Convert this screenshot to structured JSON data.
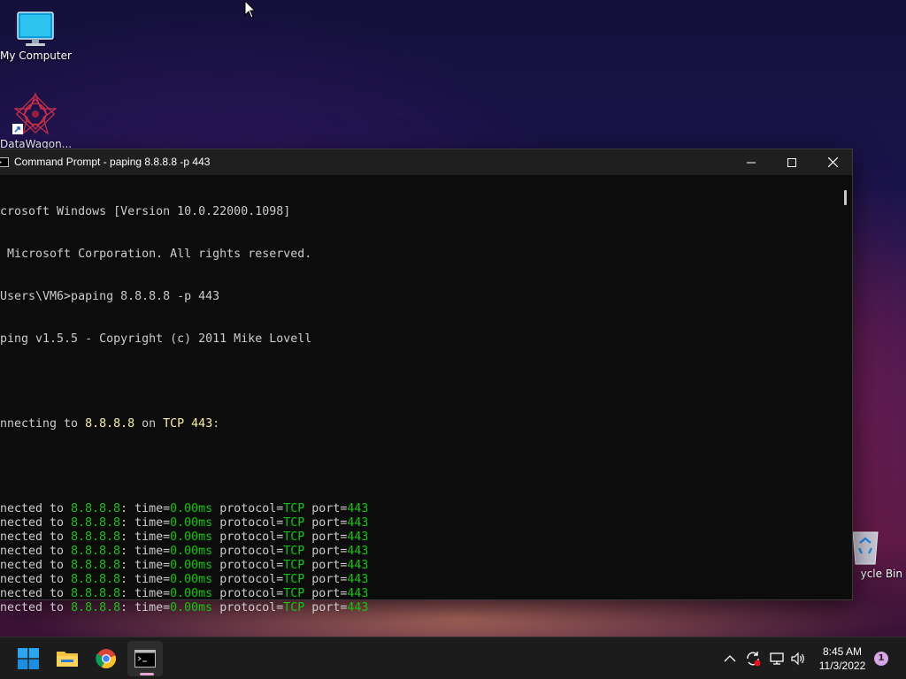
{
  "desktop": {
    "icons": [
      {
        "label": "My Computer"
      },
      {
        "label": "DataWagon..."
      },
      {
        "label": "ycle Bin"
      }
    ]
  },
  "window": {
    "title": "Command Prompt - paping  8.8.8.8 -p 443"
  },
  "console": {
    "header_lines": [
      "icrosoft Windows [Version 10.0.22000.1098]",
      ") Microsoft Corporation. All rights reserved.",
      "\\Users\\VM6>paping 8.8.8.8 -p 443",
      "aping v1.5.5 - Copyright (c) 2011 Mike Lovell"
    ],
    "connecting": {
      "prefix": "onnecting to ",
      "host": "8.8.8.8",
      "mid": " on ",
      "proto_port": "TCP 443",
      "suffix": ":"
    },
    "result_rows": [
      {
        "prefix": "nnected to ",
        "host": "8.8.8.8",
        "t_label": ": time=",
        "time": "0.00ms",
        "p_label": " protocol=",
        "protocol": "TCP",
        "port_label": " port=",
        "port": "443"
      },
      {
        "prefix": "nnected to ",
        "host": "8.8.8.8",
        "t_label": ": time=",
        "time": "0.00ms",
        "p_label": " protocol=",
        "protocol": "TCP",
        "port_label": " port=",
        "port": "443"
      },
      {
        "prefix": "nnected to ",
        "host": "8.8.8.8",
        "t_label": ": time=",
        "time": "0.00ms",
        "p_label": " protocol=",
        "protocol": "TCP",
        "port_label": " port=",
        "port": "443"
      },
      {
        "prefix": "nnected to ",
        "host": "8.8.8.8",
        "t_label": ": time=",
        "time": "0.00ms",
        "p_label": " protocol=",
        "protocol": "TCP",
        "port_label": " port=",
        "port": "443"
      },
      {
        "prefix": "nnected to ",
        "host": "8.8.8.8",
        "t_label": ": time=",
        "time": "0.00ms",
        "p_label": " protocol=",
        "protocol": "TCP",
        "port_label": " port=",
        "port": "443"
      },
      {
        "prefix": "nnected to ",
        "host": "8.8.8.8",
        "t_label": ": time=",
        "time": "0.00ms",
        "p_label": " protocol=",
        "protocol": "TCP",
        "port_label": " port=",
        "port": "443"
      },
      {
        "prefix": "nnected to ",
        "host": "8.8.8.8",
        "t_label": ": time=",
        "time": "0.00ms",
        "p_label": " protocol=",
        "protocol": "TCP",
        "port_label": " port=",
        "port": "443"
      },
      {
        "prefix": "nnected to ",
        "host": "8.8.8.8",
        "t_label": ": time=",
        "time": "0.00ms",
        "p_label": " protocol=",
        "protocol": "TCP",
        "port_label": " port=",
        "port": "443"
      }
    ]
  },
  "taskbar": {
    "apps": [
      {
        "icon": "windows-start-icon"
      },
      {
        "icon": "file-explorer-icon"
      },
      {
        "icon": "chrome-icon"
      },
      {
        "icon": "terminal-icon",
        "active": true
      }
    ],
    "tray": {
      "time": "8:45 AM",
      "date": "11/3/2022",
      "notification_count": "1"
    }
  },
  "colors": {
    "console_bg": "#0c0c0c",
    "console_text": "#cccccc",
    "highlight_yellow": "#f9f1a5",
    "highlight_green": "#16c60c"
  }
}
